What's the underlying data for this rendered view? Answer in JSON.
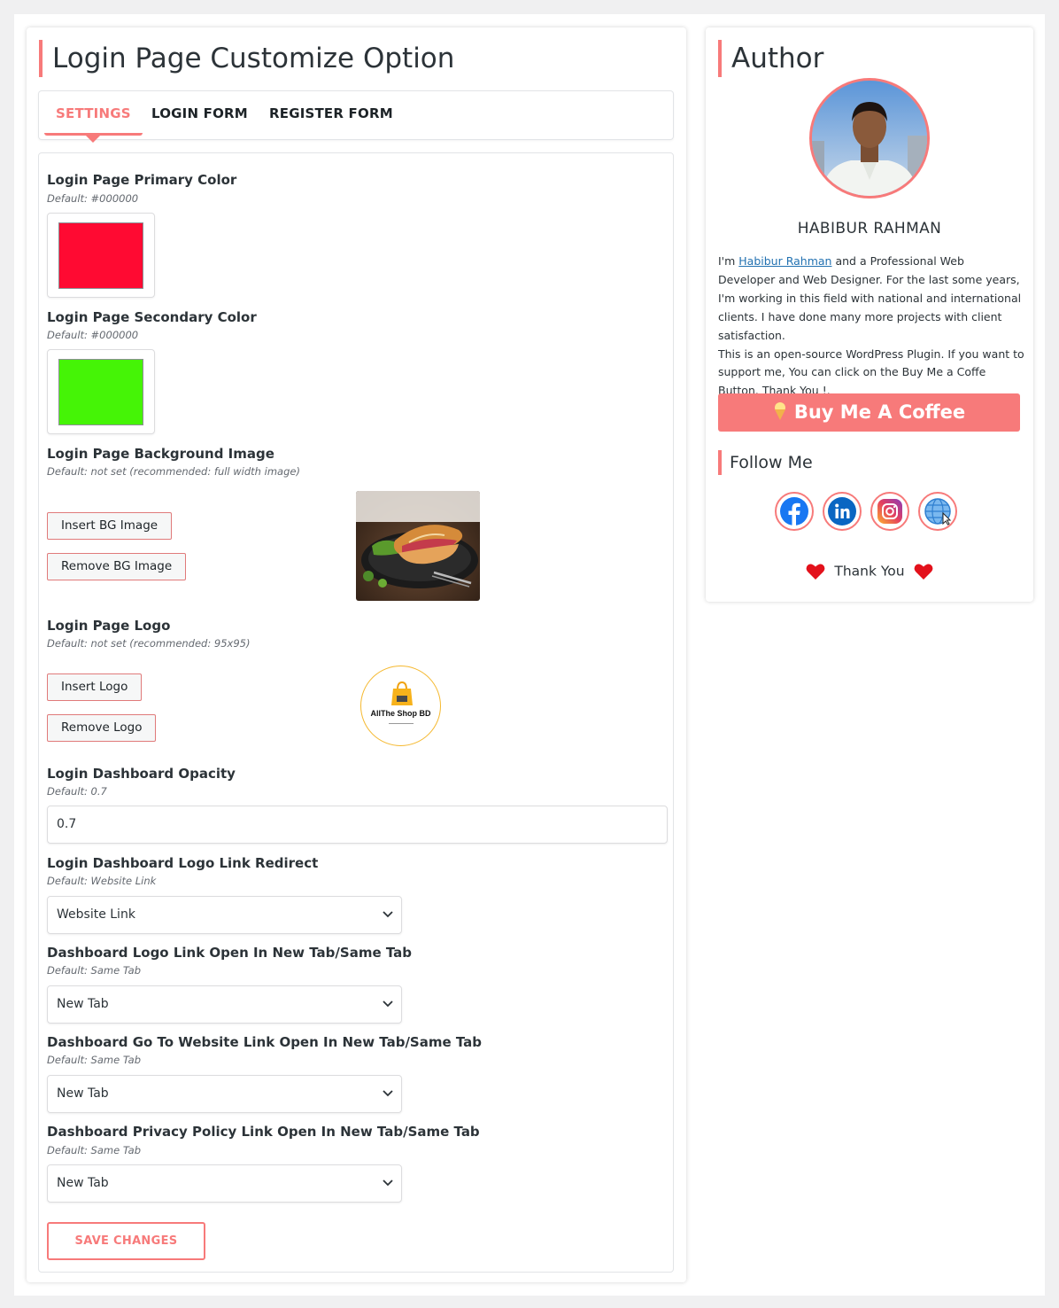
{
  "page": {
    "title": "Login Page Customize Option"
  },
  "tabs": [
    {
      "label": "SETTINGS",
      "active": true
    },
    {
      "label": "LOGIN FORM",
      "active": false
    },
    {
      "label": "REGISTER FORM",
      "active": false
    }
  ],
  "settings": {
    "primary_color": {
      "label": "Login Page Primary Color",
      "hint": "Default: #000000",
      "value": "#ff0a32"
    },
    "secondary_color": {
      "label": "Login Page Secondary Color",
      "hint": "Default: #000000",
      "value": "#45f406"
    },
    "bg_image": {
      "label": "Login Page Background Image",
      "hint": "Default: not set (recommended: full width image)",
      "insert_label": "Insert BG Image",
      "remove_label": "Remove BG Image"
    },
    "logo": {
      "label": "Login Page Logo",
      "hint": "Default: not set (recommended: 95x95)",
      "insert_label": "Insert Logo",
      "remove_label": "Remove Logo",
      "logo_text": "AllThe Shop BD"
    },
    "opacity": {
      "label": "Login Dashboard Opacity",
      "hint": "Default: 0.7",
      "value": "0.7"
    },
    "logo_redirect": {
      "label": "Login Dashboard Logo Link Redirect",
      "hint": "Default: Website Link",
      "value": "Website Link"
    },
    "logo_link_tab": {
      "label": "Dashboard Logo Link Open In New Tab/Same Tab",
      "hint": "Default: Same Tab",
      "value": "New Tab"
    },
    "website_link_tab": {
      "label": "Dashboard Go To Website Link Open In New Tab/Same Tab",
      "hint": "Default: Same Tab",
      "value": "New Tab"
    },
    "privacy_link_tab": {
      "label": "Dashboard Privacy Policy Link Open In New Tab/Same Tab",
      "hint": "Default: Same Tab",
      "value": "New Tab"
    },
    "save_label": "SAVE CHANGES"
  },
  "author": {
    "title": "Author",
    "name": "HABIBUR RAHMAN",
    "bio_prefix": "I'm ",
    "bio_link": "Habibur Rahman",
    "bio_rest": " and a Professional Web Developer and Web Designer. For the last some years, I'm working in this field with national and international clients. I have done many more projects with client satisfaction.",
    "bio_2": "This is an open-source WordPress Plugin. If you want to support me, You can click on the Buy Me a Coffe Button. Thank You !.",
    "coffee_label": "Buy Me A Coffee",
    "follow_label": "Follow Me",
    "social": [
      "facebook-icon",
      "linkedin-icon",
      "instagram-icon",
      "website-icon"
    ],
    "thanks": "Thank You"
  },
  "colors": {
    "accent": "#f77a7a",
    "link": "#2271b1"
  }
}
